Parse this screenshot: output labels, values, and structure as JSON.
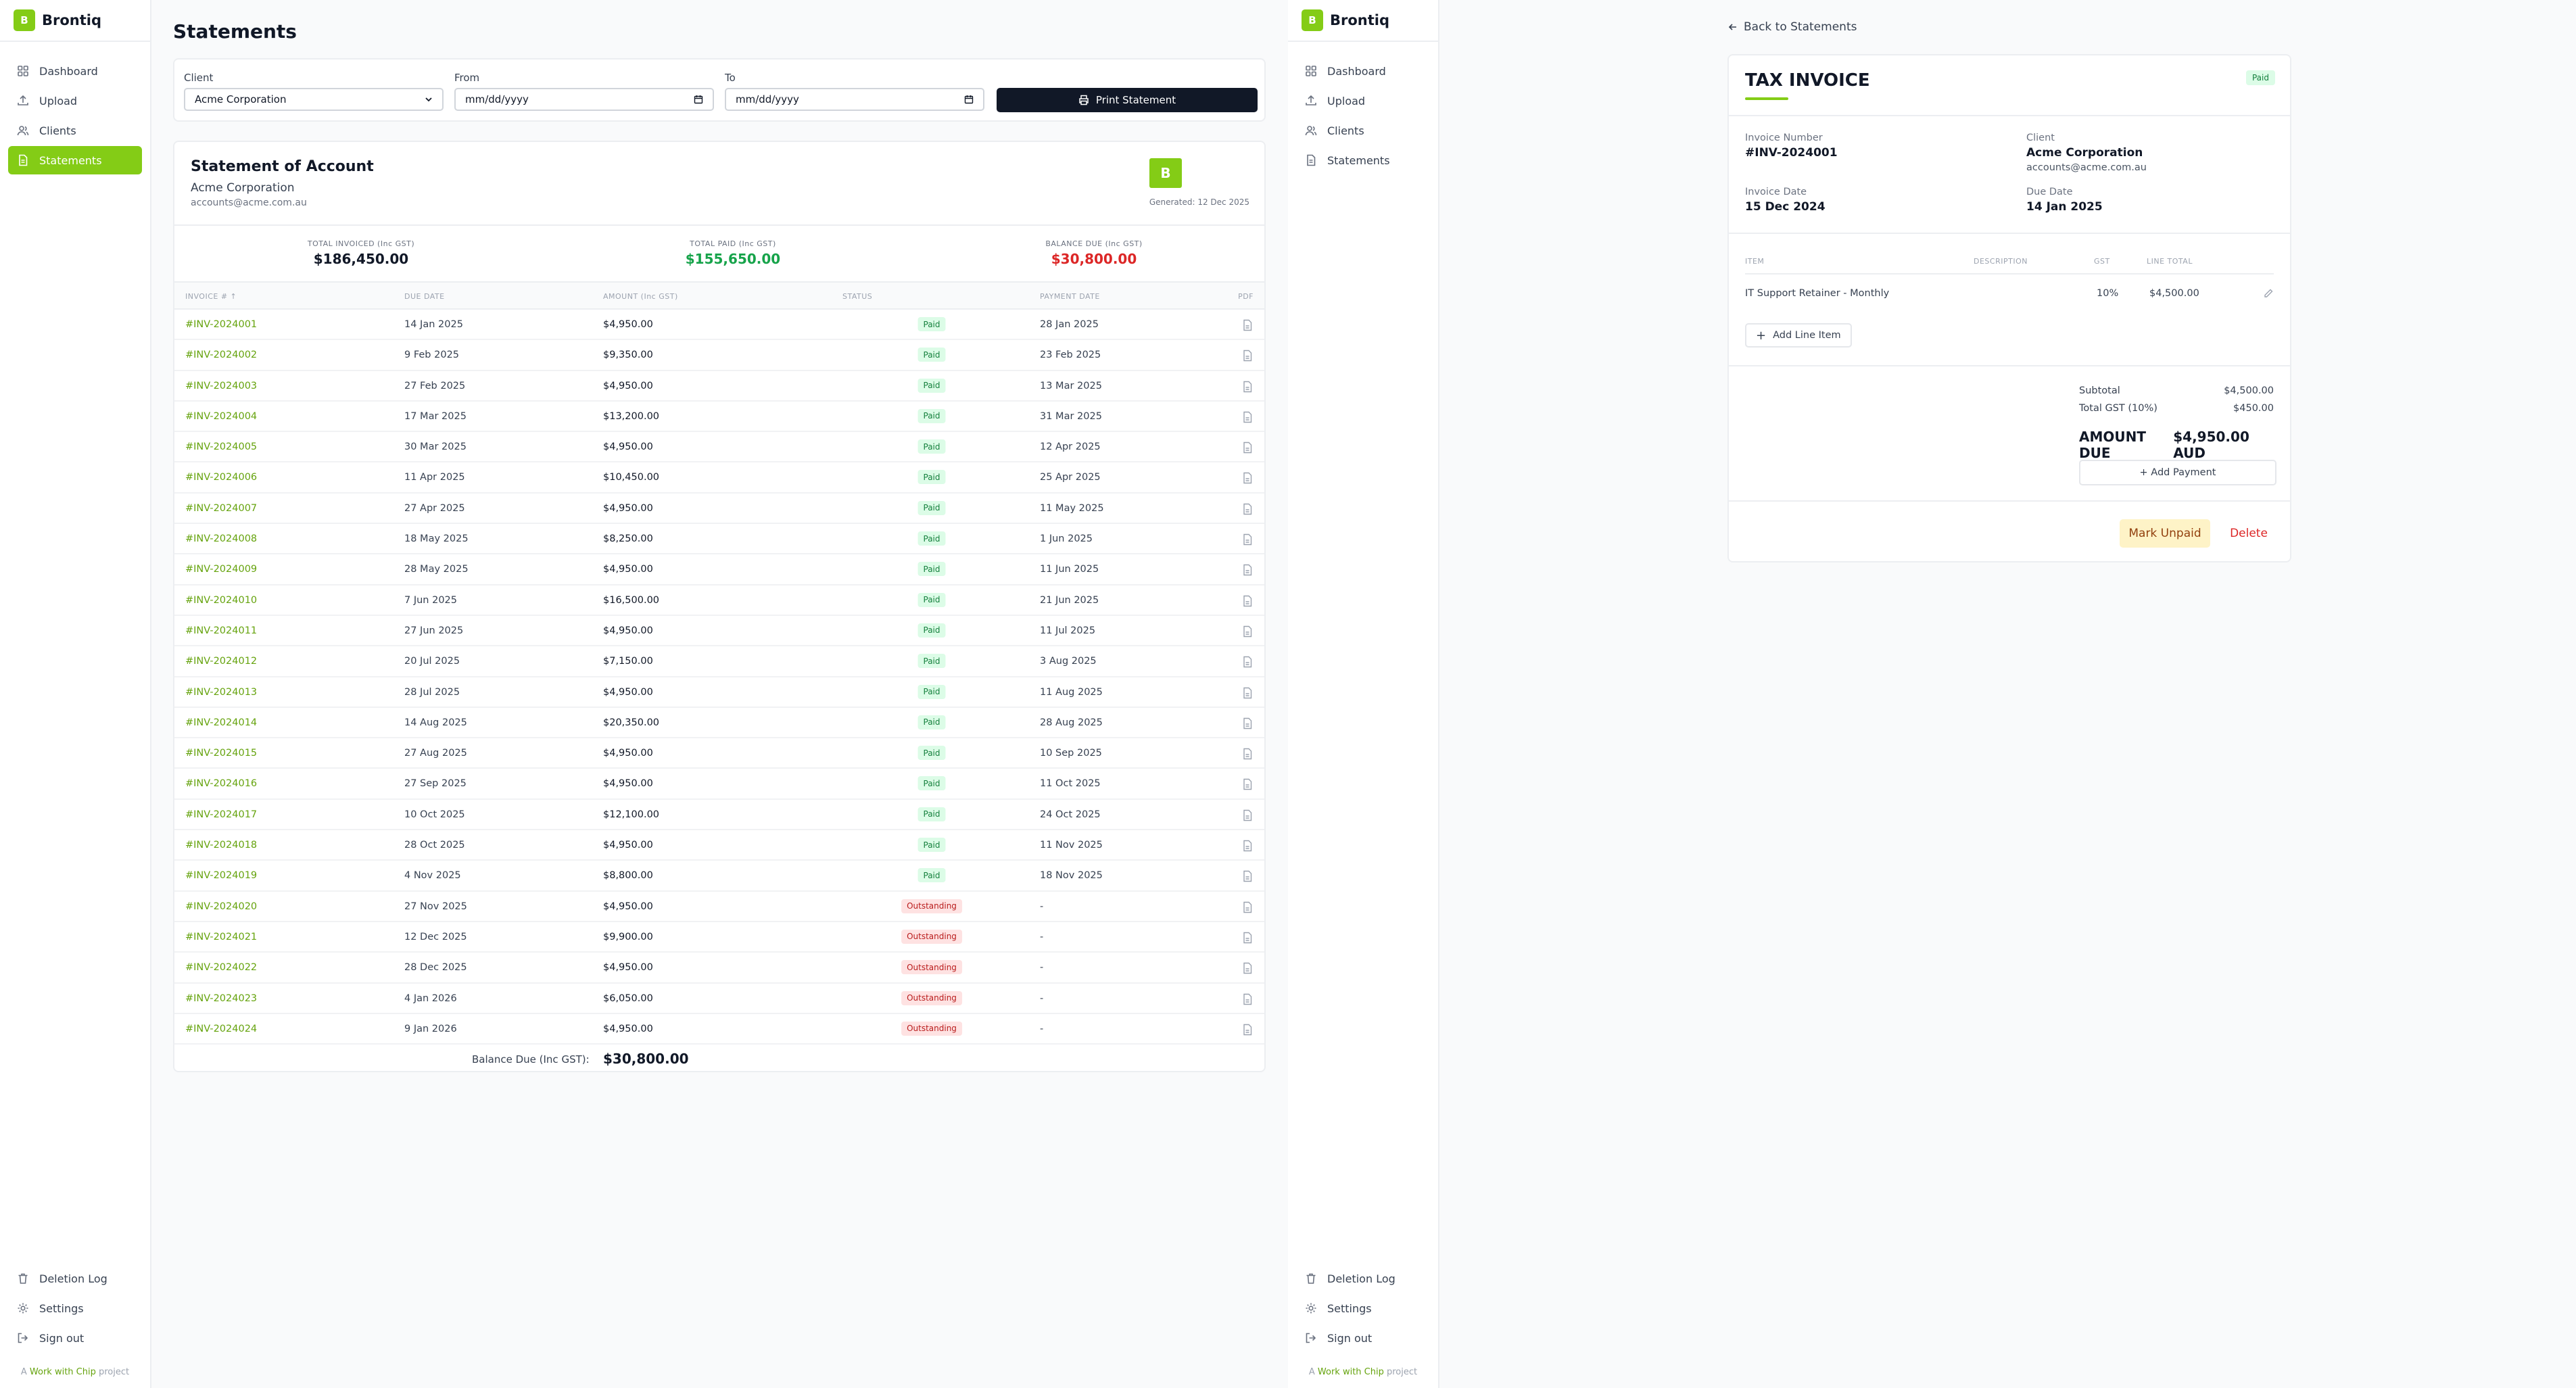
{
  "app": {
    "brand": "Brontiq",
    "logo_letter": "B"
  },
  "sidebar": {
    "items": [
      {
        "label": "Dashboard",
        "icon": "grid-icon"
      },
      {
        "label": "Upload",
        "icon": "upload-icon"
      },
      {
        "label": "Clients",
        "icon": "users-icon"
      },
      {
        "label": "Statements",
        "icon": "document-icon"
      }
    ],
    "bottom": [
      {
        "label": "Deletion Log",
        "icon": "trash-icon"
      },
      {
        "label": "Settings",
        "icon": "gear-icon"
      },
      {
        "label": "Sign out",
        "icon": "sign-out-icon"
      }
    ],
    "footer_prefix": "A ",
    "footer_link": "Work with Chip",
    "footer_suffix": " project"
  },
  "statements": {
    "page_title": "Statements",
    "filters": {
      "client_label": "Client",
      "client_value": "Acme Corporation",
      "from_label": "From",
      "from_placeholder": "mm/dd/yyyy",
      "to_label": "To",
      "to_placeholder": "mm/dd/yyyy",
      "print_label": "Print Statement"
    },
    "header": {
      "title": "Statement of Account",
      "client": "Acme Corporation",
      "email": "accounts@acme.com.au",
      "generated": "Generated: 12 Dec 2025"
    },
    "totals": {
      "invoiced_label": "TOTAL INVOICED (Inc GST)",
      "invoiced_value": "$186,450.00",
      "paid_label": "TOTAL PAID (Inc GST)",
      "paid_value": "$155,650.00",
      "due_label": "BALANCE DUE (Inc GST)",
      "due_value": "$30,800.00"
    },
    "columns": {
      "invoice": "INVOICE # ↑",
      "due_date": "DUE DATE",
      "amount": "AMOUNT (Inc GST)",
      "status": "STATUS",
      "payment_date": "PAYMENT DATE",
      "pdf": "PDF"
    },
    "rows": [
      [
        "#INV-2024001",
        "14 Jan 2025",
        "$4,950.00",
        "Paid",
        "28 Jan 2025"
      ],
      [
        "#INV-2024002",
        "9 Feb 2025",
        "$9,350.00",
        "Paid",
        "23 Feb 2025"
      ],
      [
        "#INV-2024003",
        "27 Feb 2025",
        "$4,950.00",
        "Paid",
        "13 Mar 2025"
      ],
      [
        "#INV-2024004",
        "17 Mar 2025",
        "$13,200.00",
        "Paid",
        "31 Mar 2025"
      ],
      [
        "#INV-2024005",
        "30 Mar 2025",
        "$4,950.00",
        "Paid",
        "12 Apr 2025"
      ],
      [
        "#INV-2024006",
        "11 Apr 2025",
        "$10,450.00",
        "Paid",
        "25 Apr 2025"
      ],
      [
        "#INV-2024007",
        "27 Apr 2025",
        "$4,950.00",
        "Paid",
        "11 May 2025"
      ],
      [
        "#INV-2024008",
        "18 May 2025",
        "$8,250.00",
        "Paid",
        "1 Jun 2025"
      ],
      [
        "#INV-2024009",
        "28 May 2025",
        "$4,950.00",
        "Paid",
        "11 Jun 2025"
      ],
      [
        "#INV-2024010",
        "7 Jun 2025",
        "$16,500.00",
        "Paid",
        "21 Jun 2025"
      ],
      [
        "#INV-2024011",
        "27 Jun 2025",
        "$4,950.00",
        "Paid",
        "11 Jul 2025"
      ],
      [
        "#INV-2024012",
        "20 Jul 2025",
        "$7,150.00",
        "Paid",
        "3 Aug 2025"
      ],
      [
        "#INV-2024013",
        "28 Jul 2025",
        "$4,950.00",
        "Paid",
        "11 Aug 2025"
      ],
      [
        "#INV-2024014",
        "14 Aug 2025",
        "$20,350.00",
        "Paid",
        "28 Aug 2025"
      ],
      [
        "#INV-2024015",
        "27 Aug 2025",
        "$4,950.00",
        "Paid",
        "10 Sep 2025"
      ],
      [
        "#INV-2024016",
        "27 Sep 2025",
        "$4,950.00",
        "Paid",
        "11 Oct 2025"
      ],
      [
        "#INV-2024017",
        "10 Oct 2025",
        "$12,100.00",
        "Paid",
        "24 Oct 2025"
      ],
      [
        "#INV-2024018",
        "28 Oct 2025",
        "$4,950.00",
        "Paid",
        "11 Nov 2025"
      ],
      [
        "#INV-2024019",
        "4 Nov 2025",
        "$8,800.00",
        "Paid",
        "18 Nov 2025"
      ],
      [
        "#INV-2024020",
        "27 Nov 2025",
        "$4,950.00",
        "Outstanding",
        "-"
      ],
      [
        "#INV-2024021",
        "12 Dec 2025",
        "$9,900.00",
        "Outstanding",
        "-"
      ],
      [
        "#INV-2024022",
        "28 Dec 2025",
        "$4,950.00",
        "Outstanding",
        "-"
      ],
      [
        "#INV-2024023",
        "4 Jan 2026",
        "$6,050.00",
        "Outstanding",
        "-"
      ],
      [
        "#INV-2024024",
        "9 Jan 2026",
        "$4,950.00",
        "Outstanding",
        "-"
      ]
    ],
    "balance_label": "Balance Due (Inc GST):",
    "balance_value": "$30,800.00"
  },
  "invoice": {
    "back_label": "Back to Statements",
    "title": "TAX INVOICE",
    "status": "Paid",
    "number_label": "Invoice Number",
    "number": "#INV-2024001",
    "client_label": "Client",
    "client": "Acme Corporation",
    "client_email": "accounts@acme.com.au",
    "date_label": "Invoice Date",
    "date": "15 Dec 2024",
    "due_label": "Due Date",
    "due": "14 Jan 2025",
    "columns": {
      "item": "ITEM",
      "description": "DESCRIPTION",
      "gst": "GST",
      "line_total": "LINE TOTAL"
    },
    "items": [
      {
        "item": "IT Support Retainer - Monthly",
        "description": "",
        "gst": "10%",
        "line_total": "$4,500.00"
      }
    ],
    "add_line_label": "Add Line Item",
    "subtotal_label": "Subtotal",
    "subtotal": "$4,500.00",
    "gst_label": "Total GST (10%)",
    "gst_total": "$450.00",
    "amount_due_label": "AMOUNT DUE",
    "amount_due": "$4,950.00 AUD",
    "add_payment_label": "+ Add Payment",
    "mark_unpaid_label": "Mark Unpaid",
    "delete_label": "Delete"
  },
  "colors": {
    "accent": "#84cc16",
    "paid_text": "#16a34a",
    "due_text": "#dc2626",
    "dark": "#111827"
  }
}
